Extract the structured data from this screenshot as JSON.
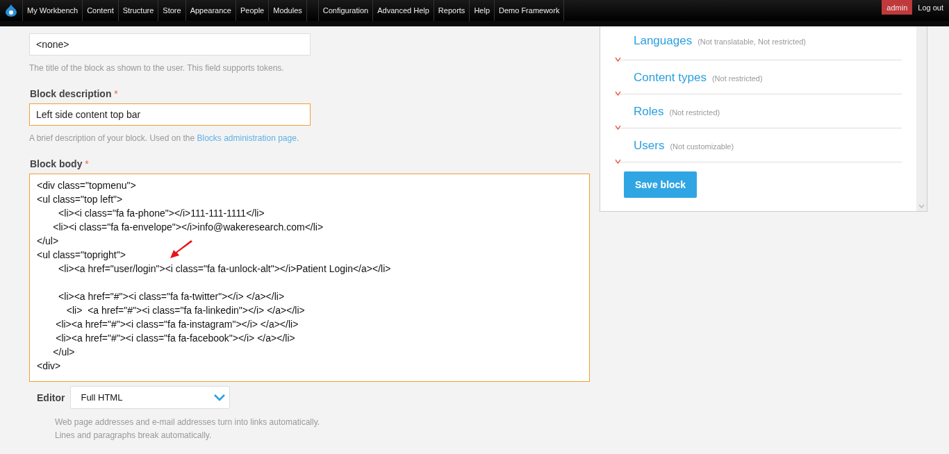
{
  "toolbar": {
    "menu": [
      {
        "label": "My Workbench"
      },
      {
        "label": "Content"
      },
      {
        "label": "Structure"
      },
      {
        "label": "Store"
      },
      {
        "label": "Appearance"
      },
      {
        "label": "People"
      },
      {
        "label": "Modules"
      },
      {
        "label": "Configuration"
      },
      {
        "label": "Advanced Help"
      },
      {
        "label": "Reports"
      },
      {
        "label": "Help"
      },
      {
        "label": "Demo Framework"
      }
    ],
    "user": "admin",
    "logout": "Log out"
  },
  "title_field": {
    "value": "<none>",
    "hint": "The title of the block as shown to the user. This field supports tokens."
  },
  "description_field": {
    "label": "Block description",
    "required_mark": "*",
    "value": "Left side content top bar",
    "hint_before": "A brief description of your block. Used on the ",
    "hint_link": "Blocks administration page",
    "hint_after": "."
  },
  "body_field": {
    "label": "Block body",
    "required_mark": "*",
    "value": "<div class=\"topmenu\">\n<ul class=\"top left\">\n        <li><i class=\"fa fa-phone\"></i>111-111-1111</li>\n      <li><i class=\"fa fa-envelope\"></i>info@wakeresearch.com</li>\n</ul>\n<ul class=\"topright\">\n        <li><a href=\"user/login\"><i class=\"fa fa-unlock-alt\"></i>Patient Login</a></li>\n\n        <li><a href=\"#\"><i class=\"fa fa-twitter\"></i> </a></li>\n           <li>  <a href=\"#\"><i class=\"fa fa-linkedin\"></i> </a></li>\n       <li><a href=\"#\"><i class=\"fa fa-instagram\"></i> </a></li>\n       <li><a href=\"#\"><i class=\"fa fa-facebook\"></i> </a></li>\n      </ul>\n<div>"
  },
  "editor": {
    "label": "Editor",
    "value": "Full HTML",
    "tips": [
      "Web page addresses and e-mail addresses turn into links automatically.",
      "Lines and paragraphs break automatically."
    ]
  },
  "visibility": [
    {
      "title": "Languages",
      "summary": "(Not translatable, Not restricted)"
    },
    {
      "title": "Content types",
      "summary": "(Not restricted)"
    },
    {
      "title": "Roles",
      "summary": "(Not restricted)"
    },
    {
      "title": "Users",
      "summary": "(Not customizable)"
    }
  ],
  "save_button": "Save block"
}
